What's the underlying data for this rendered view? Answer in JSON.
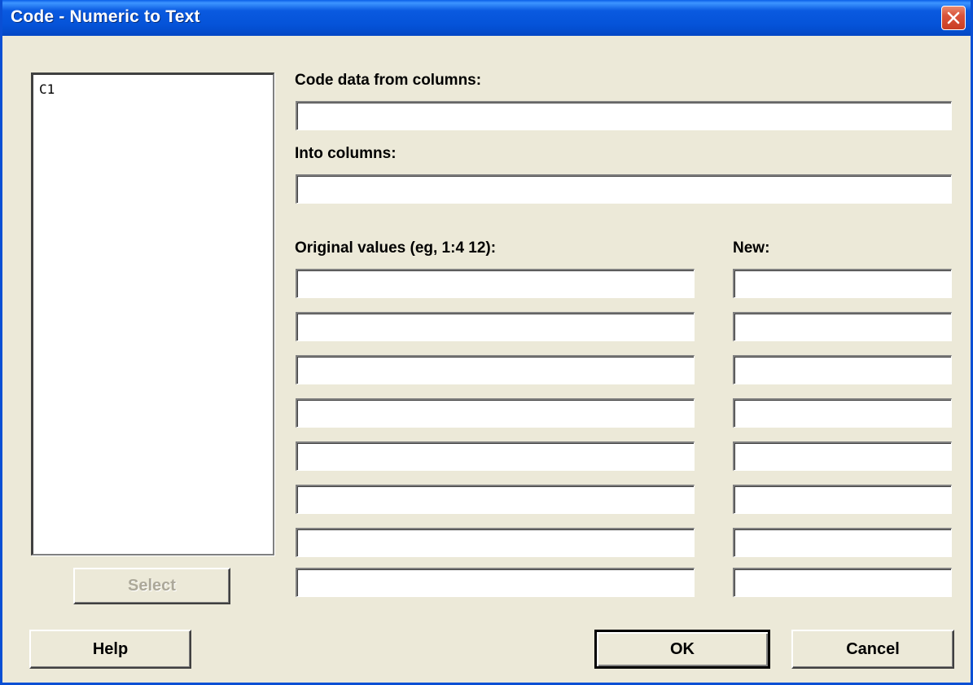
{
  "window": {
    "title": "Code - Numeric to Text"
  },
  "variables": {
    "items": [
      "C1"
    ]
  },
  "labels": {
    "code_from": "Code data from columns:",
    "into": "Into columns:",
    "original": "Original values (eg, 1:4  12):",
    "new": "New:"
  },
  "fields": {
    "code_from_value": "",
    "into_value": "",
    "original_values": [
      "",
      "",
      "",
      "",
      "",
      "",
      "",
      ""
    ],
    "new_values": [
      "",
      "",
      "",
      "",
      "",
      "",
      "",
      ""
    ]
  },
  "buttons": {
    "select": "Select",
    "help": "Help",
    "ok": "OK",
    "cancel": "Cancel"
  },
  "colors": {
    "titlebar": "#0553D8",
    "face": "#ECE9D8",
    "close": "#D9533A",
    "disabled_text": "#ACA899"
  }
}
